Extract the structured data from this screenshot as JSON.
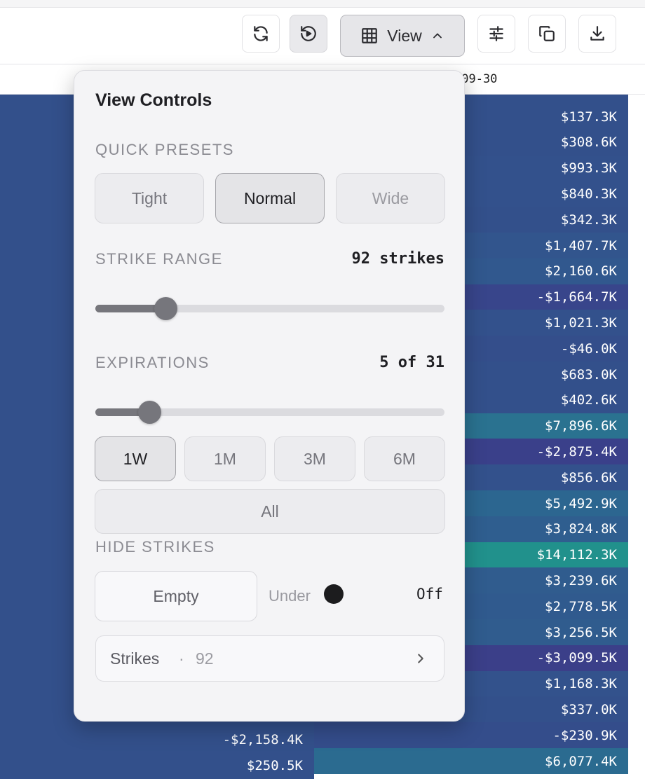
{
  "toolbar": {
    "refresh_icon": "refresh-icon",
    "replay_icon": "replay-icon",
    "view_label": "View",
    "filter_icon": "sliders-icon",
    "copy_icon": "copy-icon",
    "download_icon": "download-icon"
  },
  "grid": {
    "date_header": "-09-30",
    "left_cells": [
      {
        "value": "",
        "color": "#33508b"
      },
      {
        "value": "-$2,158.4K",
        "color": "#33508b"
      },
      {
        "value": "$250.5K",
        "color": "#33508b"
      }
    ],
    "right_cells": [
      {
        "value": "$137.3K",
        "color": "#33508b"
      },
      {
        "value": "$308.6K",
        "color": "#33508b"
      },
      {
        "value": "$993.3K",
        "color": "#33518c"
      },
      {
        "value": "$840.3K",
        "color": "#33518c"
      },
      {
        "value": "$342.3K",
        "color": "#33508b"
      },
      {
        "value": "$1,407.7K",
        "color": "#32558d"
      },
      {
        "value": "$2,160.6K",
        "color": "#31588e"
      },
      {
        "value": "-$1,664.7K",
        "color": "#38458b"
      },
      {
        "value": "$1,021.3K",
        "color": "#33518c"
      },
      {
        "value": "-$46.0K",
        "color": "#344e8b"
      },
      {
        "value": "$683.0K",
        "color": "#33508b"
      },
      {
        "value": "$402.6K",
        "color": "#33508b"
      },
      {
        "value": "$7,896.6K",
        "color": "#2a7290"
      },
      {
        "value": "-$2,875.4K",
        "color": "#3a408a"
      },
      {
        "value": "$856.6K",
        "color": "#33518c"
      },
      {
        "value": "$5,492.9K",
        "color": "#2c6690"
      },
      {
        "value": "$3,824.8K",
        "color": "#2f5e8f"
      },
      {
        "value": "$14,112.3K",
        "color": "#21918c"
      },
      {
        "value": "$3,239.6K",
        "color": "#305c8e"
      },
      {
        "value": "$2,778.5K",
        "color": "#305a8e"
      },
      {
        "value": "$3,256.5K",
        "color": "#305c8e"
      },
      {
        "value": "-$3,099.5K",
        "color": "#3b3f89"
      },
      {
        "value": "$1,168.3K",
        "color": "#33528c"
      },
      {
        "value": "$337.0K",
        "color": "#33508b"
      },
      {
        "value": "-$230.9K",
        "color": "#344d8b"
      },
      {
        "value": "$6,077.4K",
        "color": "#2b6b90"
      }
    ]
  },
  "panel": {
    "title": "View Controls",
    "quick_presets": {
      "label": "QUICK PRESETS",
      "options": [
        "Tight",
        "Normal",
        "Wide"
      ],
      "selected": "Normal"
    },
    "strike_range": {
      "label": "STRIKE RANGE",
      "value_text": "92 strikes",
      "level": 0.2
    },
    "expirations": {
      "label": "EXPIRATIONS",
      "value_text": "5 of 31",
      "level": 0.155,
      "ranges": [
        "1W",
        "1M",
        "3M",
        "6M"
      ],
      "selected": "1W",
      "all_label": "All"
    },
    "hide_strikes": {
      "label": "HIDE STRIKES",
      "empty_label": "Empty",
      "under_label": "Under",
      "under_state": "Off"
    },
    "strikes": {
      "label": "Strikes",
      "separator": "·",
      "count": "92"
    }
  }
}
